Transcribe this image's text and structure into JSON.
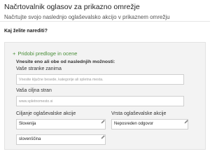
{
  "header": {
    "title": "Načrtovalnik oglasov za prikazno omrežje",
    "subtitle": "Načrtujte svojo naslednjo oglaševalsko akcijo v prikaznem omrežju"
  },
  "question": "Kaj želite narediti?",
  "panel": {
    "sign": "+",
    "title": "Pridobi predloge in ocene",
    "instruction": "Vnesite eno ali obe od naslednjih možnosti:",
    "field1": {
      "label": "Vaše stranke zanima",
      "placeholder": "Vnesite ključne besede, kategorije ali spletna mesta."
    },
    "field2": {
      "label": "Vaša ciljna stran",
      "placeholder": "www.spletnomesto.si"
    },
    "targeting": {
      "label": "Ciljanje oglaševalske akcije",
      "location": "Slovenija",
      "language": "slovenščina"
    },
    "campaign_type": {
      "label": "Vrsta oglaševalske akcije",
      "value": "Neposreden odgovor"
    }
  },
  "colors": {
    "accent_green": "#4a8f3a",
    "panel_bg": "#f3f3f3"
  }
}
